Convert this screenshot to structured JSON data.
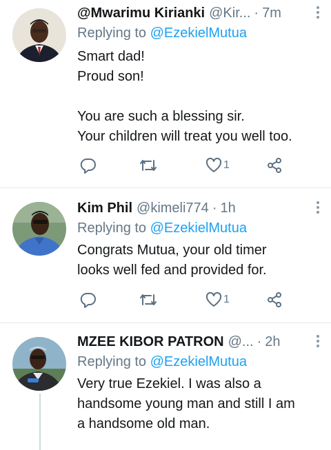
{
  "tweets": [
    {
      "name": "@Mwarimu Kirianki",
      "handle": "@Kir...",
      "sep": "·",
      "time": "7m",
      "reply_prefix": "Replying to",
      "reply_to": "@EzekielMutua",
      "body": [
        "Smart dad!",
        "Proud son!",
        "",
        "You are such a blessing sir.",
        "Your children will treat you well too."
      ],
      "likes": "1"
    },
    {
      "name": "Kim Phil",
      "handle": "@kimeli774",
      "sep": "·",
      "time": "1h",
      "reply_prefix": "Replying to",
      "reply_to": "@EzekielMutua",
      "body": [
        "Congrats Mutua, your old timer",
        "looks well fed and provided for."
      ],
      "likes": "1"
    },
    {
      "name": "MZEE KIBOR PATRON",
      "handle": "@...",
      "sep": "·",
      "time": "2h",
      "reply_prefix": "Replying to",
      "reply_to": "@EzekielMutua",
      "body": [
        "Very true Ezekiel. I was also a",
        "handsome young man and still I am",
        "a handsome old man."
      ]
    }
  ],
  "icons": {
    "reply": "reply-icon",
    "retweet": "retweet-icon",
    "like": "heart-icon",
    "share": "share-icon",
    "more": "more-vertical-icon"
  },
  "colors": {
    "link": "#1da1f2",
    "muted": "#657786",
    "icon": "#5b7083",
    "divider": "#e1e8ed"
  }
}
